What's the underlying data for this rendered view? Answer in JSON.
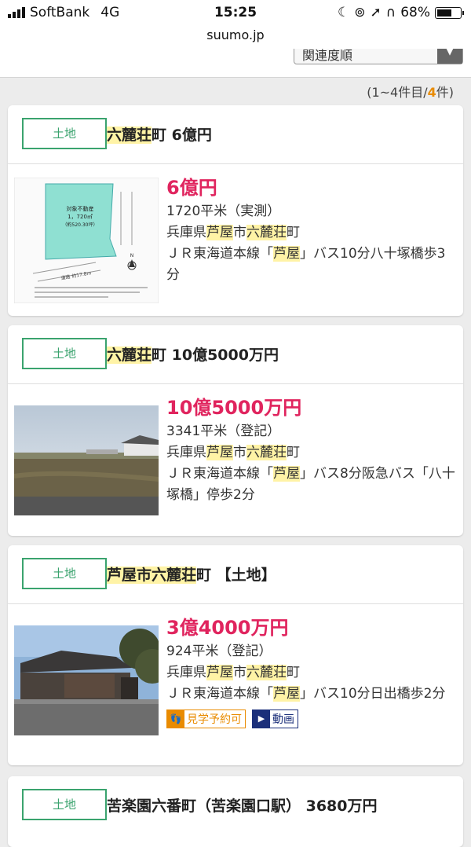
{
  "status_bar": {
    "carrier": "SoftBank",
    "network": "4G",
    "time": "15:25",
    "battery": "68%",
    "battery_level": 0.68
  },
  "browser": {
    "url": "suumo.jp"
  },
  "sort": {
    "selected": "関連度順"
  },
  "result_count": {
    "prefix": "(1~4件目/",
    "total": "4",
    "suffix": "件)"
  },
  "listings": [
    {
      "type": "土地",
      "title_hl": "六麓荘",
      "title_rest": "町 6億円",
      "price": "6億円",
      "area": "1720平米（実測）",
      "addr1": "兵庫県",
      "addr_hl1": "芦屋",
      "addr2": "市",
      "addr_hl2": "六麓荘",
      "addr3": "町",
      "access_pre": "ＪＲ東海道本線「",
      "access_hl": "芦屋",
      "access_post": "」バス10分八十塚橋歩3分",
      "plan": {
        "label1": "対象不動産",
        "label2": "1，720㎡",
        "label3": "（約520.30坪）",
        "road": "道路 約17.8m",
        "north": "N"
      }
    },
    {
      "type": "土地",
      "title_hl": "六麓荘",
      "title_rest": "町 10億5000万円",
      "price": "10億5000万円",
      "area": "3341平米（登記）",
      "addr1": "兵庫県",
      "addr_hl1": "芦屋",
      "addr2": "市",
      "addr_hl2": "六麓荘",
      "addr3": "町",
      "access_pre": "ＪＲ東海道本線「",
      "access_hl": "芦屋",
      "access_post": "」バス8分阪急バス「八十塚橋」停歩2分"
    },
    {
      "type": "土地",
      "title_hl": "芦屋市六麓荘",
      "title_rest": "町 【土地】",
      "price": "3億4000万円",
      "area": "924平米（登記）",
      "addr1": "兵庫県",
      "addr_hl1": "芦屋",
      "addr2": "市",
      "addr_hl2": "六麓荘",
      "addr3": "町",
      "access_pre": "ＪＲ東海道本線「",
      "access_hl": "芦屋",
      "access_post": "」バス10分日出橋歩2分",
      "badge_visit": "見学予約可",
      "badge_video": "動画"
    },
    {
      "type": "土地",
      "title": "苦楽園六番町（苦楽園口駅） 3680万円"
    }
  ],
  "colors": {
    "accent_green": "#3aa36e",
    "price_pink": "#e0245e",
    "highlight_yellow": "#fff3a6",
    "count_orange": "#e98b00"
  }
}
